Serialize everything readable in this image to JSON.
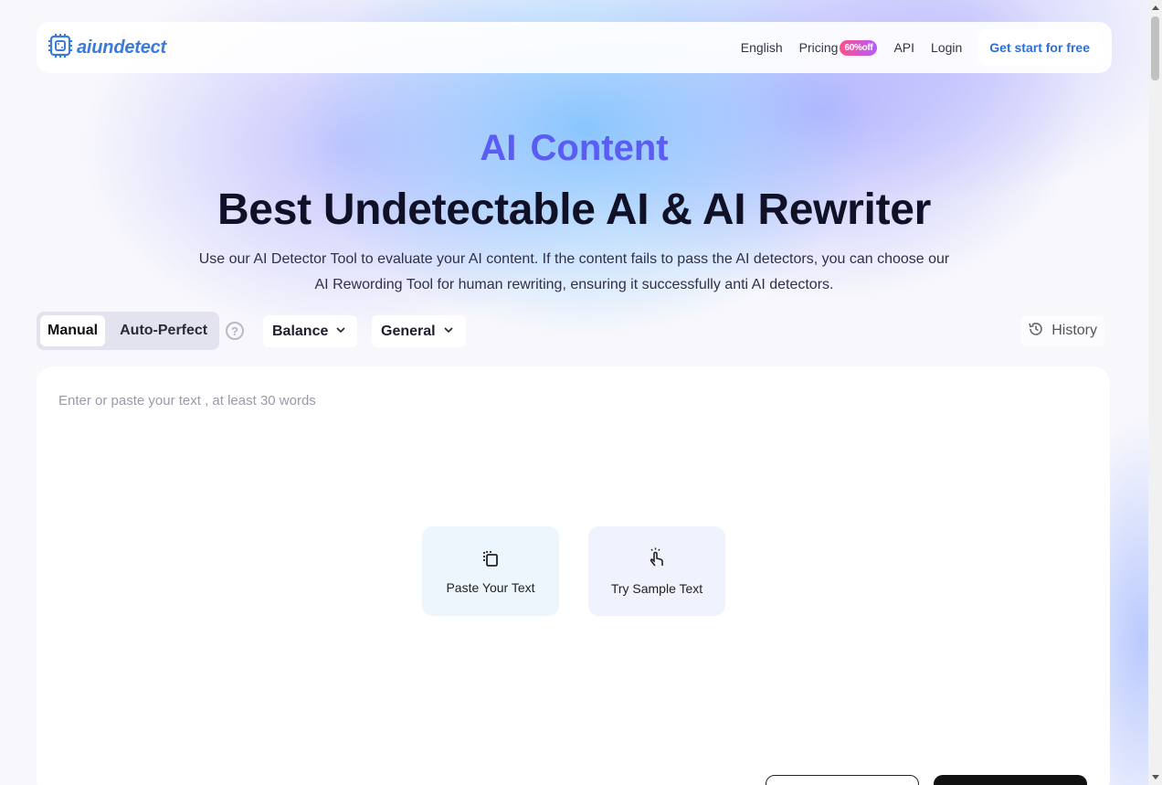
{
  "nav": {
    "logo_text": "aiundetect",
    "language": "English",
    "pricing": "Pricing",
    "pricing_badge": "60%off",
    "api": "API",
    "login": "Login",
    "cta": "Get start for free"
  },
  "hero": {
    "rotating_word_1": "AI",
    "rotating_word_2": "Content",
    "title": "Best Undetectable AI & AI Rewriter",
    "desc_line1": "Use our AI Detector Tool to evaluate your AI content. If the content fails to pass the AI detectors, you can choose our",
    "desc_line2": "AI Rewording Tool for human rewriting, ensuring it successfully anti AI detectors."
  },
  "controls": {
    "mode_manual": "Manual",
    "mode_auto": "Auto-Perfect",
    "help": "?",
    "select_strength": "Balance",
    "select_purpose": "General",
    "history": "History"
  },
  "editor": {
    "placeholder": "Enter or paste your text , at least 30 words",
    "paste_label": "Paste Your Text",
    "sample_label": "Try Sample Text"
  },
  "colors": {
    "accent": "#5a5cf2",
    "brand_blue": "#3a7ad8",
    "badge_from": "#ff4f8b",
    "badge_to": "#b45cff"
  },
  "icons": [
    "logo-icon",
    "help-icon",
    "chevron-down-icon",
    "history-icon",
    "paste-icon",
    "tap-icon"
  ]
}
